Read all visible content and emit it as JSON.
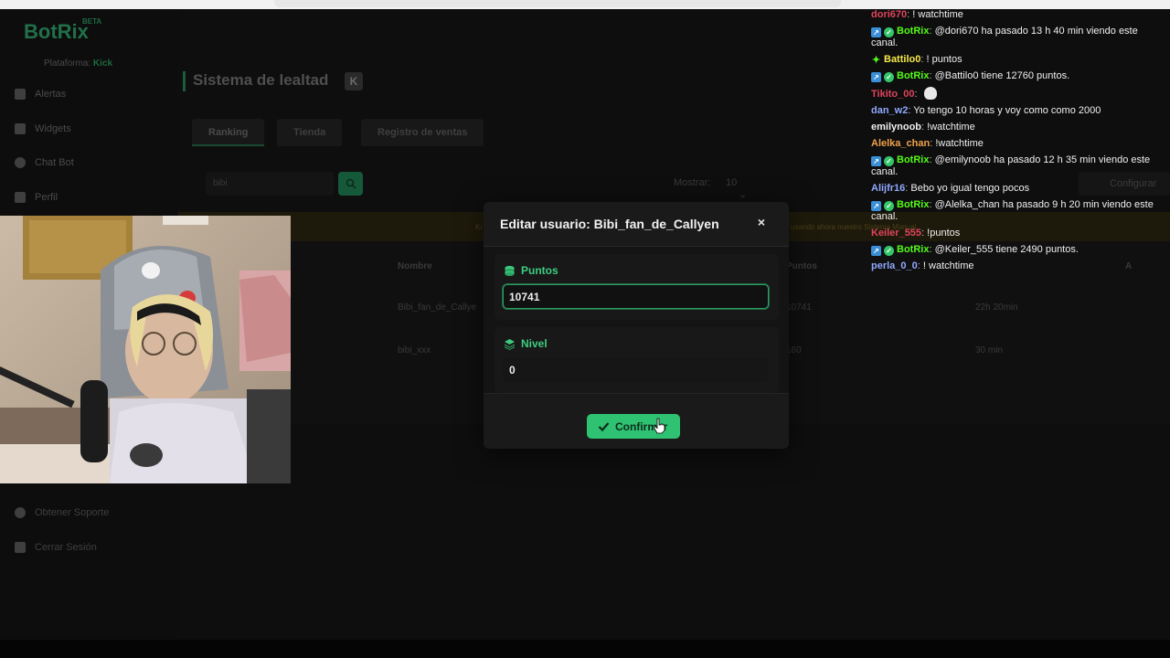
{
  "app": {
    "logo": "BotRix",
    "beta": "BETA",
    "platform_label": "Plataforma:",
    "platform_value": "Kick"
  },
  "sidebar": {
    "items": [
      {
        "label": "Alertas",
        "icon": "alert-icon"
      },
      {
        "label": "Widgets",
        "icon": "widgets-icon"
      },
      {
        "label": "Chat Bot",
        "icon": "chatbot-icon"
      },
      {
        "label": "Perfil",
        "icon": "profile-icon"
      }
    ],
    "bottom_items": [
      {
        "label": "Obtener Soporte",
        "icon": "support-icon"
      },
      {
        "label": "Cerrar Sesión",
        "icon": "logout-icon"
      }
    ]
  },
  "main": {
    "title": "Sistema de lealtad",
    "kick_badge": "K",
    "tabs": [
      {
        "label": "Ranking",
        "active": true
      },
      {
        "label": "Tienda",
        "active": false
      },
      {
        "label": "Registro de ventas",
        "active": false
      }
    ],
    "search_value": "bibi",
    "show_label": "Mostrar:",
    "show_value": "10",
    "config_label": "Configurar",
    "notice_left": "Kı",
    "notice_right": "usando ahora nuestro Sistema Manual",
    "table": {
      "headers": [
        "Nombre",
        "Puntos",
        "A"
      ],
      "rows": [
        [
          "Bibi_fan_de_Callye",
          "10741",
          "22h 20min"
        ],
        [
          "bibi_xxx",
          "160",
          "30 min"
        ]
      ]
    }
  },
  "modal": {
    "title": "Editar usuario: Bibi_fan_de_Callyen",
    "close_label": "×",
    "points_label": "Puntos",
    "points_value": "10741",
    "level_label": "Nivel",
    "level_value": "0",
    "confirm_label": "Confirmar"
  },
  "chat": [
    {
      "user": "dori670",
      "color": "#e0445c",
      "text": "! watchtime"
    },
    {
      "user": "BotRix",
      "color": "#53fc18",
      "badges": [
        "bot",
        "verified"
      ],
      "text": "@dori670 ha pasado 13 h 40 min viendo este canal."
    },
    {
      "user": "Battilo0",
      "color": "#f5e84a",
      "badges": [
        "star"
      ],
      "text": "! puntos"
    },
    {
      "user": "BotRix",
      "color": "#53fc18",
      "badges": [
        "bot",
        "verified"
      ],
      "text": "@Battilo0 tiene 12760 puntos."
    },
    {
      "user": "Tikito_00",
      "color": "#e0445c",
      "text": "",
      "emote": true
    },
    {
      "user": "dan_w2",
      "color": "#8fa8ff",
      "text": "Yo tengo 10 horas y voy como como 2000"
    },
    {
      "user": "emilynoob",
      "color": "#f0f0f0",
      "text": "!watchtime"
    },
    {
      "user": "Alelka_chan",
      "color": "#f0a24a",
      "text": "!watchtime"
    },
    {
      "user": "BotRix",
      "color": "#53fc18",
      "badges": [
        "bot",
        "verified"
      ],
      "text": "@emilynoob ha pasado 12 h 35 min viendo este canal."
    },
    {
      "user": "Alijfr16",
      "color": "#8fa8ff",
      "text": "Bebo yo igual tengo pocos"
    },
    {
      "user": "BotRix",
      "color": "#53fc18",
      "badges": [
        "bot",
        "verified"
      ],
      "text": "@Alelka_chan ha pasado 9 h 20 min viendo este canal."
    },
    {
      "user": "Keiler_555",
      "color": "#e0445c",
      "text": "!puntos"
    },
    {
      "user": "BotRix",
      "color": "#53fc18",
      "badges": [
        "bot",
        "verified"
      ],
      "text": "@Keiler_555 tiene 2490 puntos."
    },
    {
      "user": "perla_0_0",
      "color": "#8fa8ff",
      "text": "! watchtime"
    }
  ]
}
